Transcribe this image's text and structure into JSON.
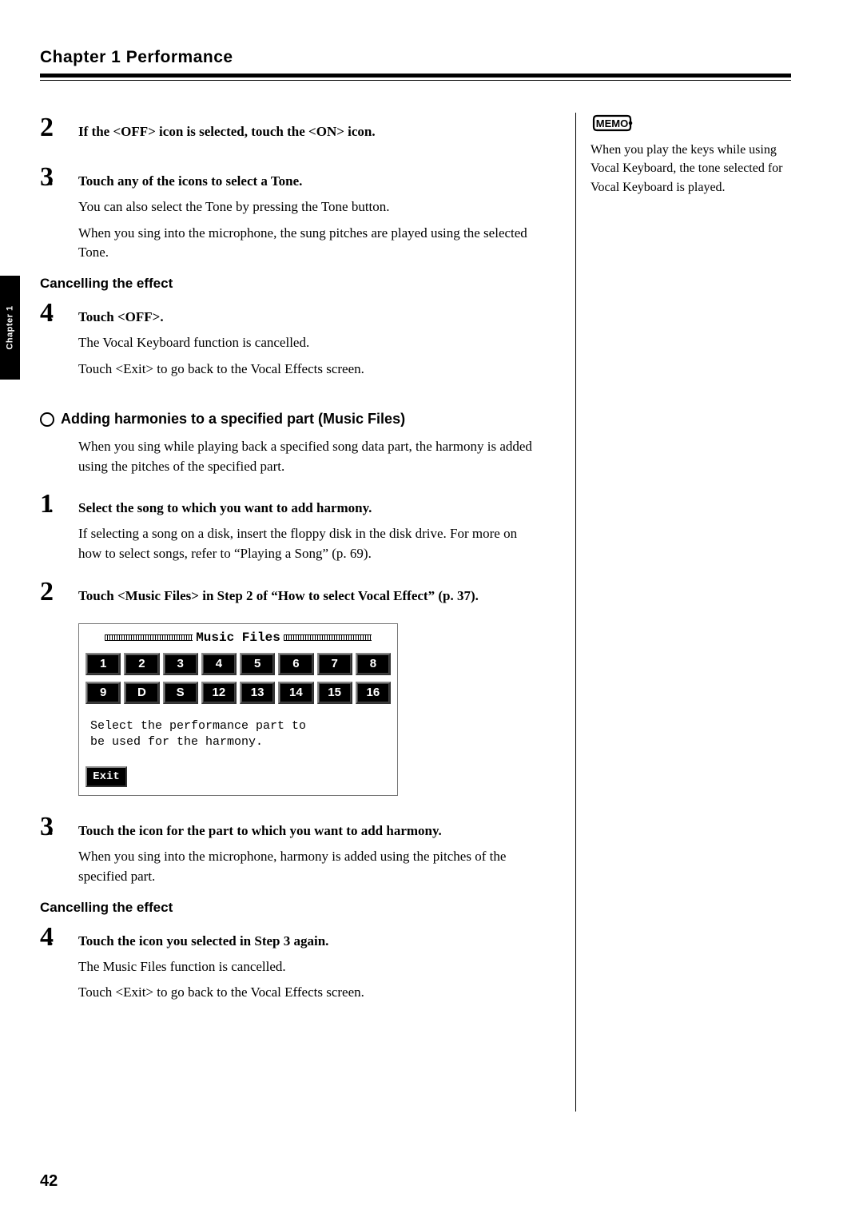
{
  "chapter_title": "Chapter 1 Performance",
  "side_tab": "Chapter 1",
  "memo": {
    "label": "MEMO",
    "text": "When you play the keys while using Vocal Keyboard, the tone selected for Vocal Keyboard is played."
  },
  "step2": {
    "num": "2",
    "text": "If the <OFF> icon is selected, touch the <ON> icon."
  },
  "step3": {
    "num": "3",
    "text": "Touch any of the icons to select a Tone.",
    "body1": "You can also select the Tone by pressing the Tone button.",
    "body2": "When you sing into the microphone, the sung pitches are played using the selected Tone."
  },
  "cancel1": "Cancelling the effect",
  "step4a": {
    "num": "4",
    "text": "Touch <OFF>.",
    "body1": "The Vocal Keyboard function is cancelled.",
    "body2": "Touch <Exit> to go back to the Vocal Effects screen."
  },
  "section2": "Adding harmonies to a specified part (Music Files)",
  "section2_body": "When you sing while playing back a specified song data part, the harmony is added using the pitches of the specified part.",
  "s2_step1": {
    "num": "1",
    "text": "Select the song to which you want to add harmony.",
    "body": "If selecting a song on a disk, insert the floppy disk in the disk drive. For more on how to select songs, refer to “Playing a Song” (p. 69)."
  },
  "s2_step2": {
    "num": "2",
    "text": "Touch <Music Files> in Step 2 of “How to select Vocal Effect” (p. 37)."
  },
  "screen": {
    "title": "Music Files",
    "row1": [
      "1",
      "2",
      "3",
      "4",
      "5",
      "6",
      "7",
      "8"
    ],
    "row2": [
      "9",
      "D",
      "S",
      "12",
      "13",
      "14",
      "15",
      "16"
    ],
    "msg1": "Select the performance part to",
    "msg2": "be used for the harmony.",
    "exit": "Exit"
  },
  "s2_step3": {
    "num": "3",
    "text": "Touch the icon for the part to which you want to add harmony.",
    "body": "When you sing into the microphone, harmony is added using the pitches of the specified part."
  },
  "cancel2": "Cancelling the effect",
  "s2_step4": {
    "num": "4",
    "text": "Touch the icon you selected in Step 3 again.",
    "body1": "The Music Files function is cancelled.",
    "body2": "Touch <Exit> to go back to the Vocal Effects screen."
  },
  "page_number": "42"
}
